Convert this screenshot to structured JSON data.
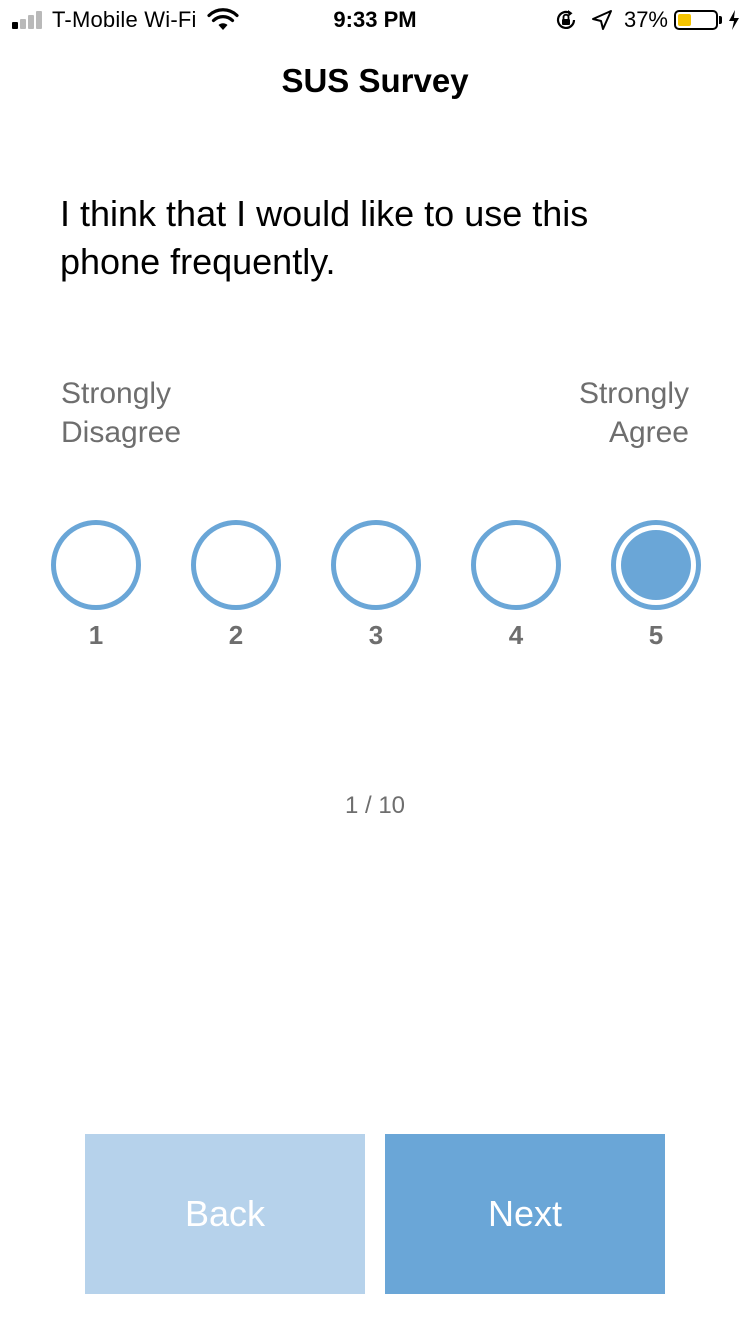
{
  "status_bar": {
    "carrier": "T-Mobile Wi-Fi",
    "time": "9:33 PM",
    "battery_percent": "37%",
    "battery_level": 0.37,
    "signal_bars_filled": 1,
    "signal_bars_total": 4,
    "icons": [
      "signal-icon",
      "wifi-icon",
      "orientation-lock-icon",
      "location-icon",
      "battery-icon",
      "charging-icon"
    ]
  },
  "nav": {
    "title": "SUS Survey"
  },
  "question": {
    "text": "I think that I would like to use this phone frequently."
  },
  "scale": {
    "left_label": [
      "Strongly",
      "Disagree"
    ],
    "right_label": [
      "Strongly",
      "Agree"
    ],
    "options": [
      "1",
      "2",
      "3",
      "4",
      "5"
    ],
    "selected": "5"
  },
  "progress": {
    "text": "1 / 10"
  },
  "buttons": {
    "back_label": "Back",
    "next_label": "Next"
  },
  "colors": {
    "accent": "#6aa6d7",
    "accent_light": "#b6d2eb",
    "secondary_text": "#6e6e6e",
    "battery_fill": "#f5c400"
  }
}
